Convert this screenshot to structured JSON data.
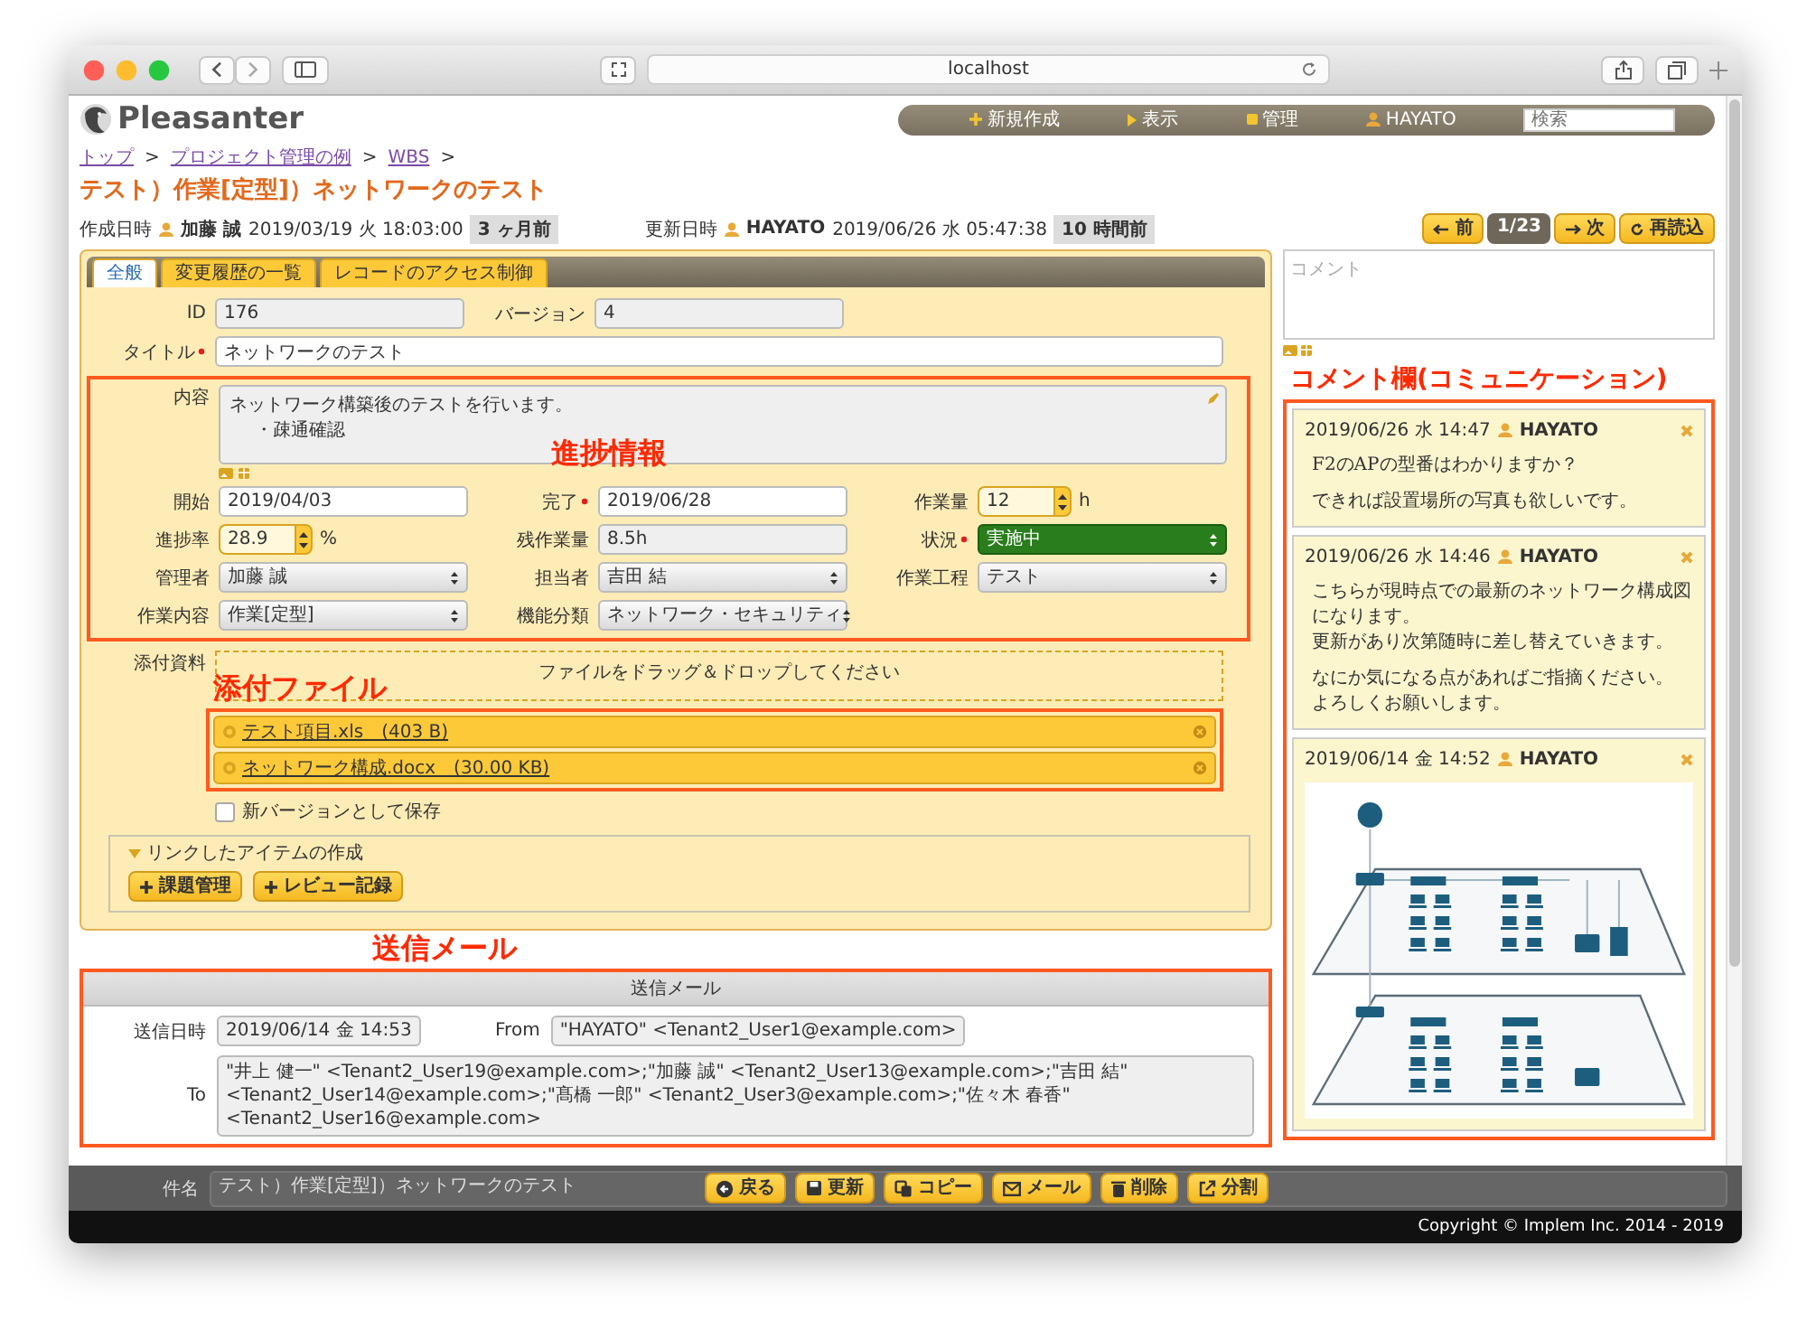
{
  "browser": {
    "address": "localhost"
  },
  "header": {
    "logo": "Pleasanter",
    "menu": [
      {
        "kind": "new",
        "label": "新規作成"
      },
      {
        "kind": "view",
        "label": "表示"
      },
      {
        "kind": "admin",
        "label": "管理"
      },
      {
        "kind": "user",
        "label": "HAYATO"
      }
    ],
    "search": {
      "placeholder": "検索"
    }
  },
  "breadcrumb": {
    "items": [
      "トップ",
      "プロジェクト管理の例",
      "WBS"
    ],
    "separator": ">"
  },
  "title": "テスト）作業[定型]）ネットワークのテスト",
  "record_info": {
    "created_label": "作成日時",
    "created_by": "加藤 誠",
    "created_at": "2019/03/19 火 18:03:00",
    "created_ago": "3 ヶ月前",
    "updated_label": "更新日時",
    "updated_by": "HAYATO",
    "updated_at": "2019/06/26 水 05:47:38",
    "updated_ago": "10 時間前"
  },
  "pager": {
    "prev": "前",
    "position": "1/23",
    "next": "次",
    "reload": "再読込"
  },
  "tabs": [
    {
      "label": "全般",
      "selected": true
    },
    {
      "label": "変更履歴の一覧",
      "selected": false
    },
    {
      "label": "レコードのアクセス制御",
      "selected": false
    }
  ],
  "form": {
    "rows": [
      [
        {
          "label": "ID",
          "kind": "readonly",
          "value": "176",
          "required": false
        },
        {
          "label": "バージョン",
          "kind": "readonly",
          "value": "4",
          "required": false
        }
      ],
      [
        {
          "label": "タイトル",
          "kind": "text",
          "value": "ネットワークのテスト",
          "required": true
        }
      ]
    ],
    "progress": {
      "annotation": "進捗情報",
      "content": {
        "label": "内容",
        "lines": [
          {
            "text": "ネットワーク構築後のテストを行います。",
            "indent": false
          },
          {
            "text": "・疎通確認",
            "indent": true
          }
        ]
      },
      "rows": [
        [
          {
            "label": "開始",
            "kind": "text",
            "value": "2019/04/03",
            "required": false
          },
          {
            "label": "完了",
            "kind": "text",
            "value": "2019/06/28",
            "required": true
          },
          {
            "label": "作業量",
            "kind": "spinner",
            "value": "12",
            "unit": "h",
            "required": false
          }
        ],
        [
          {
            "label": "進捗率",
            "kind": "spinner",
            "value": "28.9",
            "unit": "%",
            "required": false
          },
          {
            "label": "残作業量",
            "kind": "readonly",
            "value": "8.5h",
            "required": false
          },
          {
            "label": "状況",
            "kind": "status",
            "value": "実施中",
            "color": "#2a7d1c",
            "required": true
          }
        ],
        [
          {
            "label": "管理者",
            "kind": "select",
            "value": "加藤 誠",
            "required": false
          },
          {
            "label": "担当者",
            "kind": "select",
            "value": "吉田 結",
            "required": false
          },
          {
            "label": "作業工程",
            "kind": "select",
            "value": "テスト",
            "required": false
          }
        ],
        [
          {
            "label": "作業内容",
            "kind": "select",
            "value": "作業[定型]",
            "required": false
          },
          {
            "label": "機能分類",
            "kind": "select",
            "value": "ネットワーク・セキュリティ",
            "required": false
          }
        ]
      ]
    },
    "attachments": {
      "label": "添付資料",
      "dropzone": "ファイルをドラッグ＆ドロップしてください",
      "annotation": "添付ファイル",
      "files": [
        {
          "name": "テスト項目.xls　(403 B)"
        },
        {
          "name": "ネットワーク構成.docx　(30.00 KB)"
        }
      ]
    },
    "new_version": {
      "label": "新バージョンとして保存",
      "checked": false
    },
    "linked_items": {
      "legend": "リンクしたアイテムの作成",
      "expanded": true,
      "buttons": [
        "課題管理",
        "レビュー記録"
      ]
    }
  },
  "mail": {
    "annotation": "送信メール",
    "title": "送信メール",
    "sent_label": "送信日時",
    "sent_at": "2019/06/14 金 14:53",
    "from_label": "From",
    "from": "\"HAYATO\" <Tenant2_User1@example.com>",
    "to_label": "To",
    "to": "\"井上 健一\" <Tenant2_User19@example.com>;\"加藤 誠\" <Tenant2_User13@example.com>;\"吉田 結\" <Tenant2_User14@example.com>;\"髙橋 一郎\" <Tenant2_User3@example.com>;\"佐々木 春香\" <Tenant2_User16@example.com>"
  },
  "command_bar": {
    "subject_label": "件名",
    "subject": "テスト）作業[定型]）ネットワークのテスト",
    "buttons": [
      {
        "kind": "back",
        "label": "戻る"
      },
      {
        "kind": "save",
        "label": "更新"
      },
      {
        "kind": "copy",
        "label": "コピー"
      },
      {
        "kind": "mail",
        "label": "メール"
      },
      {
        "kind": "delete",
        "label": "削除"
      },
      {
        "kind": "split",
        "label": "分割"
      }
    ]
  },
  "comments": {
    "placeholder": "コメント",
    "annotation": "コメント欄(コミュニケーション)",
    "items": [
      {
        "date": "2019/06/26 水 14:47",
        "user": "HAYATO",
        "kind": "text",
        "paragraphs": [
          [
            "F2のAPの型番はわかりますか？"
          ],
          [
            "できれば設置場所の写真も欲しいです。"
          ]
        ]
      },
      {
        "date": "2019/06/26 水 14:46",
        "user": "HAYATO",
        "kind": "text",
        "paragraphs": [
          [
            "こちらが現時点での最新のネットワーク構成図になります。",
            "更新があり次第随時に差し替えていきます。"
          ],
          [
            "なにか気になる点があればご指摘ください。",
            "よろしくお願いします。"
          ]
        ]
      },
      {
        "date": "2019/06/14 金 14:52",
        "user": "HAYATO",
        "kind": "picture"
      }
    ]
  },
  "footer": "Copyright © Implem Inc. 2014 - 2019"
}
